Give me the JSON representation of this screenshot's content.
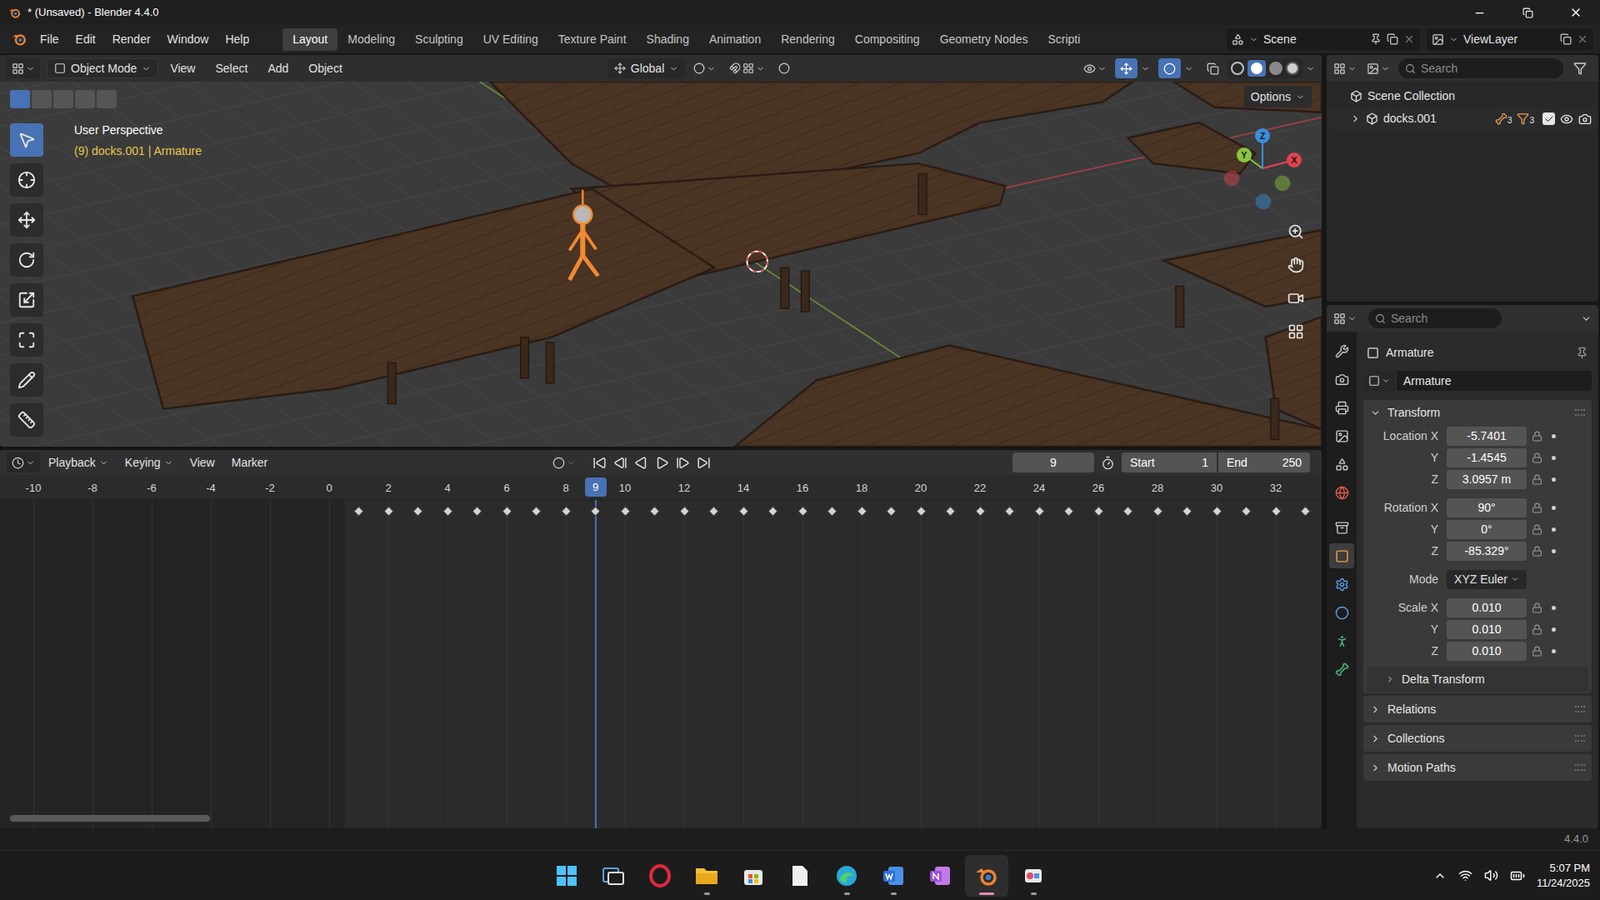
{
  "window": {
    "title": "* (Unsaved) - Blender 4.4.0"
  },
  "menus": [
    "File",
    "Edit",
    "Render",
    "Window",
    "Help"
  ],
  "workspaces": [
    {
      "label": "Layout",
      "selected": true
    },
    {
      "label": "Modeling",
      "selected": false
    },
    {
      "label": "Sculpting",
      "selected": false
    },
    {
      "label": "UV Editing",
      "selected": false
    },
    {
      "label": "Texture Paint",
      "selected": false
    },
    {
      "label": "Shading",
      "selected": false
    },
    {
      "label": "Animation",
      "selected": false
    },
    {
      "label": "Rendering",
      "selected": false
    },
    {
      "label": "Compositing",
      "selected": false
    },
    {
      "label": "Geometry Nodes",
      "selected": false
    },
    {
      "label": "Scripti",
      "selected": false
    }
  ],
  "scene": {
    "label": "Scene"
  },
  "view_layer": {
    "label": "ViewLayer"
  },
  "viewport": {
    "mode": "Object Mode",
    "menus": [
      "View",
      "Select",
      "Add",
      "Object"
    ],
    "orientation": "Global",
    "options": "Options",
    "view_name": "User Perspective",
    "context": "(9) docks.001 | Armature",
    "gizmo_axes": [
      {
        "label": "X",
        "color": "#e0434f"
      },
      {
        "label": "Y",
        "color": "#8bc53f"
      },
      {
        "label": "Z",
        "color": "#3a8fde"
      }
    ],
    "tools": [
      {
        "selected": true
      },
      {
        "selected": false
      },
      {
        "selected": false
      },
      {
        "selected": false
      },
      {
        "selected": false
      },
      {
        "selected": false
      },
      {
        "selected": false
      },
      {
        "selected": false
      }
    ]
  },
  "timeline": {
    "menus": [
      "Playback",
      "Keying",
      "View",
      "Marker"
    ],
    "current_frame": "9",
    "start_label": "Start",
    "start": "1",
    "end_label": "End",
    "end": "250",
    "ruler": [
      "-10",
      "-8",
      "-6",
      "-4",
      "-2",
      "0",
      "2",
      "4",
      "6",
      "8",
      "10",
      "12",
      "14",
      "16",
      "18",
      "20",
      "22",
      "24",
      "26",
      "28",
      "30",
      "32"
    ],
    "keyframes": [
      1,
      2,
      3,
      4,
      5,
      6,
      7,
      8,
      9,
      10,
      11,
      12,
      13,
      14,
      15,
      16,
      17,
      18,
      19,
      20,
      21,
      22,
      23,
      24,
      25,
      26,
      27,
      28,
      29,
      30,
      31,
      32,
      33
    ]
  },
  "outliner": {
    "search_placeholder": "Search",
    "items": [
      {
        "label": "Scene Collection",
        "expanded": true
      },
      {
        "label": "docks.001",
        "expanded": false
      }
    ],
    "badges": [
      "3",
      "3"
    ],
    "checked": true,
    "visible": true
  },
  "properties": {
    "search_placeholder": "Search",
    "tabs": [
      {
        "selected": false,
        "color": "#c8c8c8"
      },
      {
        "selected": false,
        "color": "#c8c8c8"
      },
      {
        "selected": false,
        "color": "#c8c8c8"
      },
      {
        "selected": false,
        "color": "#c8c8c8"
      },
      {
        "selected": false,
        "color": "#c8c8c8"
      },
      {
        "selected": false,
        "color": "#e05a4a"
      },
      {
        "selected": false,
        "color": "#c8c8c8"
      },
      {
        "selected": true,
        "color": "#f0a050"
      },
      {
        "selected": false,
        "color": "#5a9ee0"
      },
      {
        "selected": false,
        "color": "#5a9ee0"
      },
      {
        "selected": false,
        "color": "#4fc080"
      },
      {
        "selected": false,
        "color": "#4fc080"
      }
    ],
    "object_name": "Armature",
    "name_field": "Armature",
    "transform": {
      "label": "Transform",
      "expanded": true,
      "rows": [
        {
          "label": "Location X",
          "value": "-5.7401",
          "kind": "number"
        },
        {
          "label": "Y",
          "value": "-1.4545",
          "kind": "number"
        },
        {
          "label": "Z",
          "value": "3.0957 m",
          "kind": "number"
        },
        {
          "label": "Rotation X",
          "value": "90°",
          "kind": "number"
        },
        {
          "label": "Y",
          "value": "0°",
          "kind": "number"
        },
        {
          "label": "Z",
          "value": "-85.329°",
          "kind": "number"
        },
        {
          "label": "Mode",
          "value": "XYZ Euler",
          "kind": "dropdown"
        },
        {
          "label": "Scale X",
          "value": "0.010",
          "kind": "number"
        },
        {
          "label": "Y",
          "value": "0.010",
          "kind": "number"
        },
        {
          "label": "Z",
          "value": "0.010",
          "kind": "number"
        }
      ],
      "subpanels": [
        {
          "label": "Delta Transform",
          "expanded": false
        }
      ]
    },
    "panels": [
      {
        "label": "Relations",
        "expanded": false
      },
      {
        "label": "Collections",
        "expanded": false
      },
      {
        "label": "Motion Paths",
        "expanded": false
      }
    ]
  },
  "status_bar": {
    "version": "4.4.0"
  },
  "taskbar": {
    "time": "5:07 PM",
    "date": "11/24/2025",
    "apps": [
      {
        "kind": "start",
        "running": false,
        "focused": false,
        "color": "#4cc2ff"
      },
      {
        "kind": "taskview",
        "running": false,
        "focused": false,
        "color": "#5aa0e8"
      },
      {
        "kind": "opera",
        "running": false,
        "focused": false,
        "color": "#e0283c"
      },
      {
        "kind": "explorer",
        "running": true,
        "focused": false,
        "color": "#f2c233"
      },
      {
        "kind": "store",
        "running": false,
        "focused": false,
        "color": "#3d8ee0"
      },
      {
        "kind": "file",
        "running": false,
        "focused": false,
        "color": "#f0f0f0"
      },
      {
        "kind": "edge",
        "running": true,
        "focused": false,
        "color": "#2aa7d8"
      },
      {
        "kind": "word",
        "running": true,
        "focused": false,
        "color": "#2b6ed6"
      },
      {
        "kind": "onenote",
        "running": false,
        "focused": false,
        "color": "#9b4fd0"
      },
      {
        "kind": "blender",
        "running": true,
        "focused": true,
        "color": "#f0822e"
      },
      {
        "kind": "snip",
        "running": true,
        "focused": false,
        "color": "#e04a6a"
      }
    ]
  }
}
